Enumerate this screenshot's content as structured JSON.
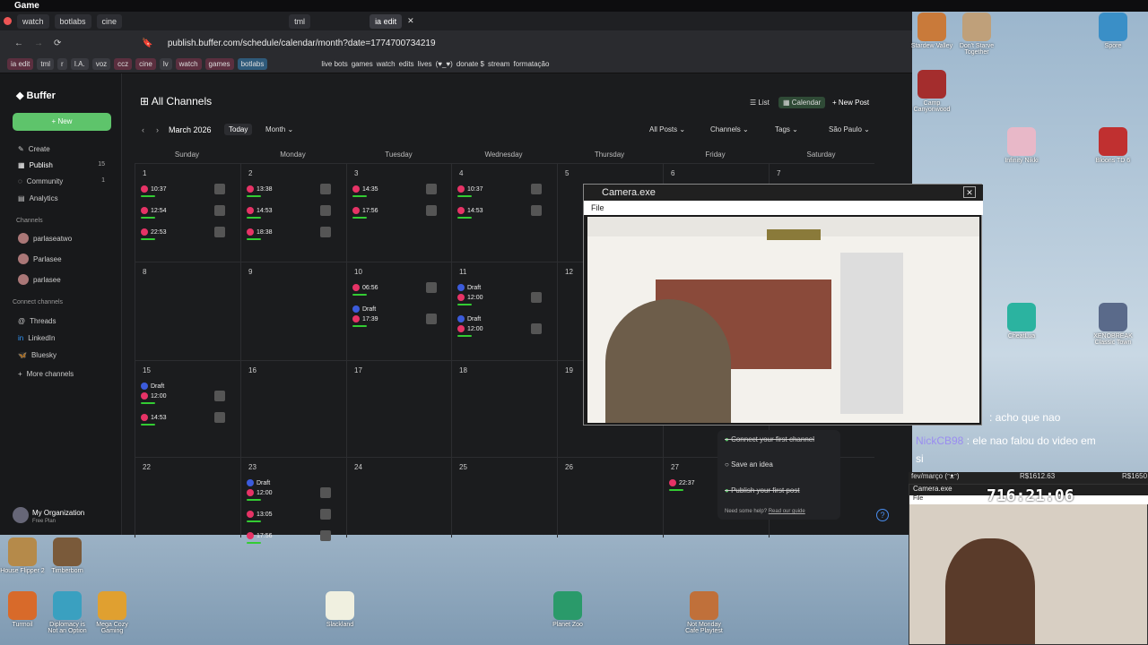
{
  "window": {
    "title": "Game"
  },
  "tabs": [
    "watch",
    "botlabs",
    "cine",
    "tml",
    "ia edit"
  ],
  "url": "publish.buffer.com/schedule/calendar/month?date=1774700734219",
  "bookmarks": [
    "ia edit",
    "tml",
    "r",
    "I.A.",
    "voz",
    "ccz",
    "cine",
    "lv",
    "watch",
    "games",
    "botlabs",
    "live bots",
    "games",
    "watch",
    "edits",
    "lives",
    "(♥_♥)",
    "donate $",
    "stream",
    "formatação"
  ],
  "sidebar": {
    "brand": "Buffer",
    "new_label": "New",
    "items": [
      {
        "label": "Create"
      },
      {
        "label": "Publish",
        "badge": "15"
      },
      {
        "label": "Community",
        "badge": "1"
      },
      {
        "label": "Analytics"
      }
    ],
    "channels_heading": "Channels",
    "channels": [
      "parlaseatwo",
      "Parlasee",
      "parlasee"
    ],
    "connect_heading": "Connect channels",
    "connect": [
      "Threads",
      "LinkedIn",
      "Bluesky",
      "More channels"
    ],
    "org": "My Organization",
    "plan": "Free Plan"
  },
  "calendar": {
    "title": "All Channels",
    "month": "March 2026",
    "today": "Today",
    "view": "Month",
    "list": "List",
    "cal": "Calendar",
    "new_post": "New Post",
    "filters": [
      "All Posts",
      "Channels",
      "Tags",
      "São Paulo"
    ],
    "days": [
      "Sunday",
      "Monday",
      "Tuesday",
      "Wednesday",
      "Thursday",
      "Friday",
      "Saturday"
    ],
    "weeks": [
      [
        "1",
        "2",
        "3",
        "4",
        "5",
        "6",
        "7"
      ],
      [
        "8",
        "9",
        "10",
        "11",
        "12",
        "",
        ""
      ],
      [
        "15",
        "16",
        "17",
        "18",
        "19",
        "",
        ""
      ],
      [
        "22",
        "23",
        "24",
        "25",
        "26",
        "27",
        ""
      ]
    ],
    "posts": [
      {
        "w": 0,
        "d": 0,
        "slots": [
          "10:37",
          "12:54",
          "22:53"
        ]
      },
      {
        "w": 0,
        "d": 1,
        "slots": [
          "13:38",
          "14:53",
          "18:38"
        ]
      },
      {
        "w": 0,
        "d": 2,
        "slots": [
          "14:35",
          "17:56"
        ]
      },
      {
        "w": 0,
        "d": 3,
        "slots": [
          "10:37",
          "14:53"
        ]
      },
      {
        "w": 1,
        "d": 2,
        "slots": [
          "06:56",
          "Draft",
          "17:39"
        ]
      },
      {
        "w": 1,
        "d": 3,
        "slots": [
          "Draft",
          "12:00",
          "Draft",
          "12:00"
        ]
      },
      {
        "w": 2,
        "d": 0,
        "slots": [
          "Draft",
          "12:00",
          "14:53"
        ]
      },
      {
        "w": 3,
        "d": 1,
        "slots": [
          "Draft",
          "12:00",
          "13:05",
          "17:56"
        ]
      },
      {
        "w": 3,
        "d": 5,
        "slots": [
          "22:37"
        ]
      }
    ],
    "draft_friday": [
      "Draft",
      "12:00"
    ]
  },
  "onboarding": {
    "items": [
      "Connect your first channel",
      "Save an idea",
      "Publish your first post"
    ],
    "help": "Need some help?",
    "guide": "Read our guide"
  },
  "camera": {
    "title": "Camera.exe",
    "menu": "File"
  },
  "chat": {
    "line1": ": acho que nao",
    "user2": "NickCB98",
    "line2": ": ele nao falou do video em",
    "line3": "si"
  },
  "stream": {
    "label": "fev/março (ᵔᴥᵔ)",
    "money1": "R$1612.63",
    "money2": "R$1650",
    "timer": "716:21:06",
    "cam": "Camera.exe",
    "file": "File"
  },
  "desktop_icons": [
    {
      "name": "Stardew Valley"
    },
    {
      "name": "Don't Starve Together"
    },
    {
      "name": "Spore"
    },
    {
      "name": "Camp Canyonwood"
    },
    {
      "name": "Infinity Nikki"
    },
    {
      "name": "Bloons TD 6"
    },
    {
      "name": "CheatLua"
    },
    {
      "name": "XENOBREAK Classic Town"
    },
    {
      "name": "House Flipper 2"
    },
    {
      "name": "Timberborn"
    },
    {
      "name": "Turmoil"
    },
    {
      "name": "Diplomacy is Not an Option"
    },
    {
      "name": "Mega Cozy Gaming"
    },
    {
      "name": "Slackland"
    },
    {
      "name": "Planet Zoo"
    },
    {
      "name": "Not Monday Cafe Playtest"
    }
  ]
}
